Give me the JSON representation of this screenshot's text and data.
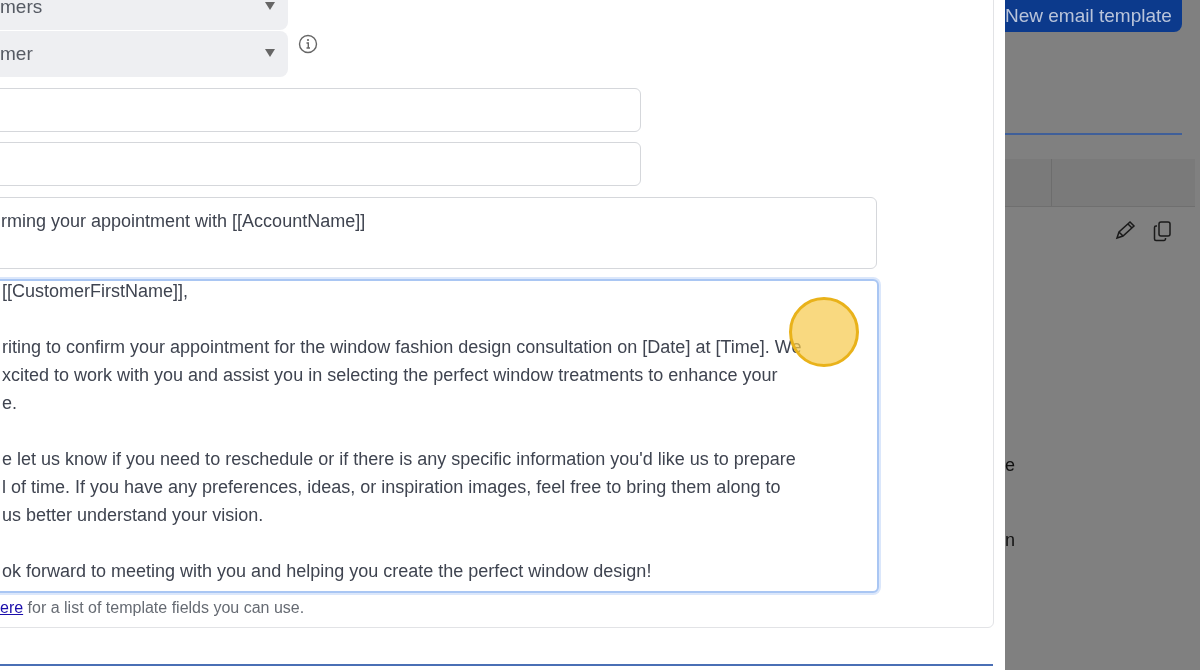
{
  "form": {
    "selects": [
      {
        "value": "mers",
        "info": false
      },
      {
        "value": "mer",
        "info": true
      }
    ],
    "subject": "rming your appointment with [[AccountName]]",
    "body": {
      "focused": true,
      "paragraphs": [
        [
          "[[CustomerFirstName]],"
        ],
        [
          "riting to confirm your appointment for the window fashion design consultation on [Date] at [Time]. We",
          "xcited to work with you and assist you in selecting the perfect window treatments to enhance your",
          "e."
        ],
        [
          "e let us know if you need to reschedule or if there is any specific information you'd like us to prepare",
          "l of time. If you have any preferences, ideas, or inspiration images, feel free to bring them along to",
          "us better understand your vision."
        ],
        [
          "ok forward to meeting with you and helping you create the perfect window design!"
        ]
      ]
    },
    "help": {
      "link": "ere",
      "text": " for a list of template fields you can use."
    }
  },
  "background": {
    "new_button": "New email template",
    "row_fragments": [
      "e",
      "n"
    ]
  }
}
